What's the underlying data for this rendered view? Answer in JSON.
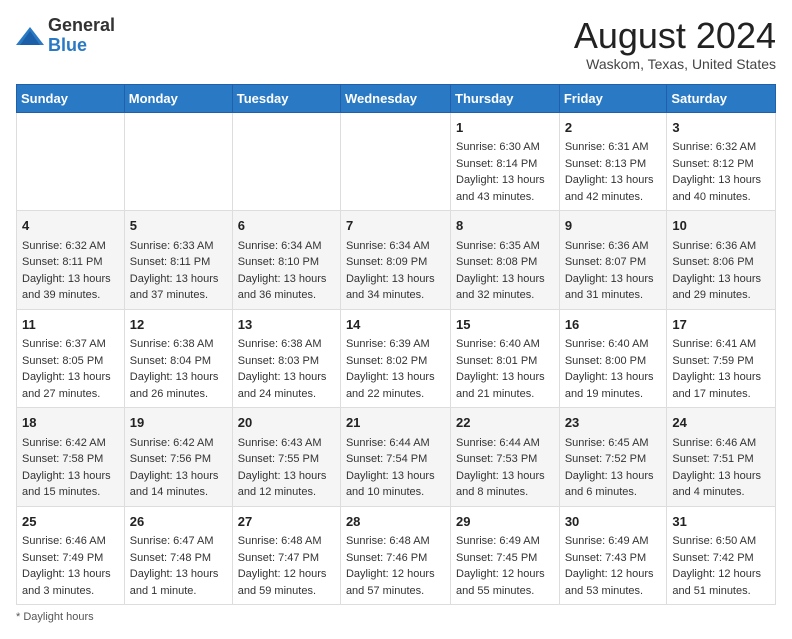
{
  "header": {
    "logo_general": "General",
    "logo_blue": "Blue",
    "month_title": "August 2024",
    "location": "Waskom, Texas, United States"
  },
  "days_of_week": [
    "Sunday",
    "Monday",
    "Tuesday",
    "Wednesday",
    "Thursday",
    "Friday",
    "Saturday"
  ],
  "weeks": [
    [
      {
        "day": "",
        "sunrise": "",
        "sunset": "",
        "daylight": ""
      },
      {
        "day": "",
        "sunrise": "",
        "sunset": "",
        "daylight": ""
      },
      {
        "day": "",
        "sunrise": "",
        "sunset": "",
        "daylight": ""
      },
      {
        "day": "",
        "sunrise": "",
        "sunset": "",
        "daylight": ""
      },
      {
        "day": "1",
        "sunrise": "Sunrise: 6:30 AM",
        "sunset": "Sunset: 8:14 PM",
        "daylight": "Daylight: 13 hours and 43 minutes."
      },
      {
        "day": "2",
        "sunrise": "Sunrise: 6:31 AM",
        "sunset": "Sunset: 8:13 PM",
        "daylight": "Daylight: 13 hours and 42 minutes."
      },
      {
        "day": "3",
        "sunrise": "Sunrise: 6:32 AM",
        "sunset": "Sunset: 8:12 PM",
        "daylight": "Daylight: 13 hours and 40 minutes."
      }
    ],
    [
      {
        "day": "4",
        "sunrise": "Sunrise: 6:32 AM",
        "sunset": "Sunset: 8:11 PM",
        "daylight": "Daylight: 13 hours and 39 minutes."
      },
      {
        "day": "5",
        "sunrise": "Sunrise: 6:33 AM",
        "sunset": "Sunset: 8:11 PM",
        "daylight": "Daylight: 13 hours and 37 minutes."
      },
      {
        "day": "6",
        "sunrise": "Sunrise: 6:34 AM",
        "sunset": "Sunset: 8:10 PM",
        "daylight": "Daylight: 13 hours and 36 minutes."
      },
      {
        "day": "7",
        "sunrise": "Sunrise: 6:34 AM",
        "sunset": "Sunset: 8:09 PM",
        "daylight": "Daylight: 13 hours and 34 minutes."
      },
      {
        "day": "8",
        "sunrise": "Sunrise: 6:35 AM",
        "sunset": "Sunset: 8:08 PM",
        "daylight": "Daylight: 13 hours and 32 minutes."
      },
      {
        "day": "9",
        "sunrise": "Sunrise: 6:36 AM",
        "sunset": "Sunset: 8:07 PM",
        "daylight": "Daylight: 13 hours and 31 minutes."
      },
      {
        "day": "10",
        "sunrise": "Sunrise: 6:36 AM",
        "sunset": "Sunset: 8:06 PM",
        "daylight": "Daylight: 13 hours and 29 minutes."
      }
    ],
    [
      {
        "day": "11",
        "sunrise": "Sunrise: 6:37 AM",
        "sunset": "Sunset: 8:05 PM",
        "daylight": "Daylight: 13 hours and 27 minutes."
      },
      {
        "day": "12",
        "sunrise": "Sunrise: 6:38 AM",
        "sunset": "Sunset: 8:04 PM",
        "daylight": "Daylight: 13 hours and 26 minutes."
      },
      {
        "day": "13",
        "sunrise": "Sunrise: 6:38 AM",
        "sunset": "Sunset: 8:03 PM",
        "daylight": "Daylight: 13 hours and 24 minutes."
      },
      {
        "day": "14",
        "sunrise": "Sunrise: 6:39 AM",
        "sunset": "Sunset: 8:02 PM",
        "daylight": "Daylight: 13 hours and 22 minutes."
      },
      {
        "day": "15",
        "sunrise": "Sunrise: 6:40 AM",
        "sunset": "Sunset: 8:01 PM",
        "daylight": "Daylight: 13 hours and 21 minutes."
      },
      {
        "day": "16",
        "sunrise": "Sunrise: 6:40 AM",
        "sunset": "Sunset: 8:00 PM",
        "daylight": "Daylight: 13 hours and 19 minutes."
      },
      {
        "day": "17",
        "sunrise": "Sunrise: 6:41 AM",
        "sunset": "Sunset: 7:59 PM",
        "daylight": "Daylight: 13 hours and 17 minutes."
      }
    ],
    [
      {
        "day": "18",
        "sunrise": "Sunrise: 6:42 AM",
        "sunset": "Sunset: 7:58 PM",
        "daylight": "Daylight: 13 hours and 15 minutes."
      },
      {
        "day": "19",
        "sunrise": "Sunrise: 6:42 AM",
        "sunset": "Sunset: 7:56 PM",
        "daylight": "Daylight: 13 hours and 14 minutes."
      },
      {
        "day": "20",
        "sunrise": "Sunrise: 6:43 AM",
        "sunset": "Sunset: 7:55 PM",
        "daylight": "Daylight: 13 hours and 12 minutes."
      },
      {
        "day": "21",
        "sunrise": "Sunrise: 6:44 AM",
        "sunset": "Sunset: 7:54 PM",
        "daylight": "Daylight: 13 hours and 10 minutes."
      },
      {
        "day": "22",
        "sunrise": "Sunrise: 6:44 AM",
        "sunset": "Sunset: 7:53 PM",
        "daylight": "Daylight: 13 hours and 8 minutes."
      },
      {
        "day": "23",
        "sunrise": "Sunrise: 6:45 AM",
        "sunset": "Sunset: 7:52 PM",
        "daylight": "Daylight: 13 hours and 6 minutes."
      },
      {
        "day": "24",
        "sunrise": "Sunrise: 6:46 AM",
        "sunset": "Sunset: 7:51 PM",
        "daylight": "Daylight: 13 hours and 4 minutes."
      }
    ],
    [
      {
        "day": "25",
        "sunrise": "Sunrise: 6:46 AM",
        "sunset": "Sunset: 7:49 PM",
        "daylight": "Daylight: 13 hours and 3 minutes."
      },
      {
        "day": "26",
        "sunrise": "Sunrise: 6:47 AM",
        "sunset": "Sunset: 7:48 PM",
        "daylight": "Daylight: 13 hours and 1 minute."
      },
      {
        "day": "27",
        "sunrise": "Sunrise: 6:48 AM",
        "sunset": "Sunset: 7:47 PM",
        "daylight": "Daylight: 12 hours and 59 minutes."
      },
      {
        "day": "28",
        "sunrise": "Sunrise: 6:48 AM",
        "sunset": "Sunset: 7:46 PM",
        "daylight": "Daylight: 12 hours and 57 minutes."
      },
      {
        "day": "29",
        "sunrise": "Sunrise: 6:49 AM",
        "sunset": "Sunset: 7:45 PM",
        "daylight": "Daylight: 12 hours and 55 minutes."
      },
      {
        "day": "30",
        "sunrise": "Sunrise: 6:49 AM",
        "sunset": "Sunset: 7:43 PM",
        "daylight": "Daylight: 12 hours and 53 minutes."
      },
      {
        "day": "31",
        "sunrise": "Sunrise: 6:50 AM",
        "sunset": "Sunset: 7:42 PM",
        "daylight": "Daylight: 12 hours and 51 minutes."
      }
    ]
  ],
  "footer": {
    "daylight_label": "Daylight hours"
  }
}
